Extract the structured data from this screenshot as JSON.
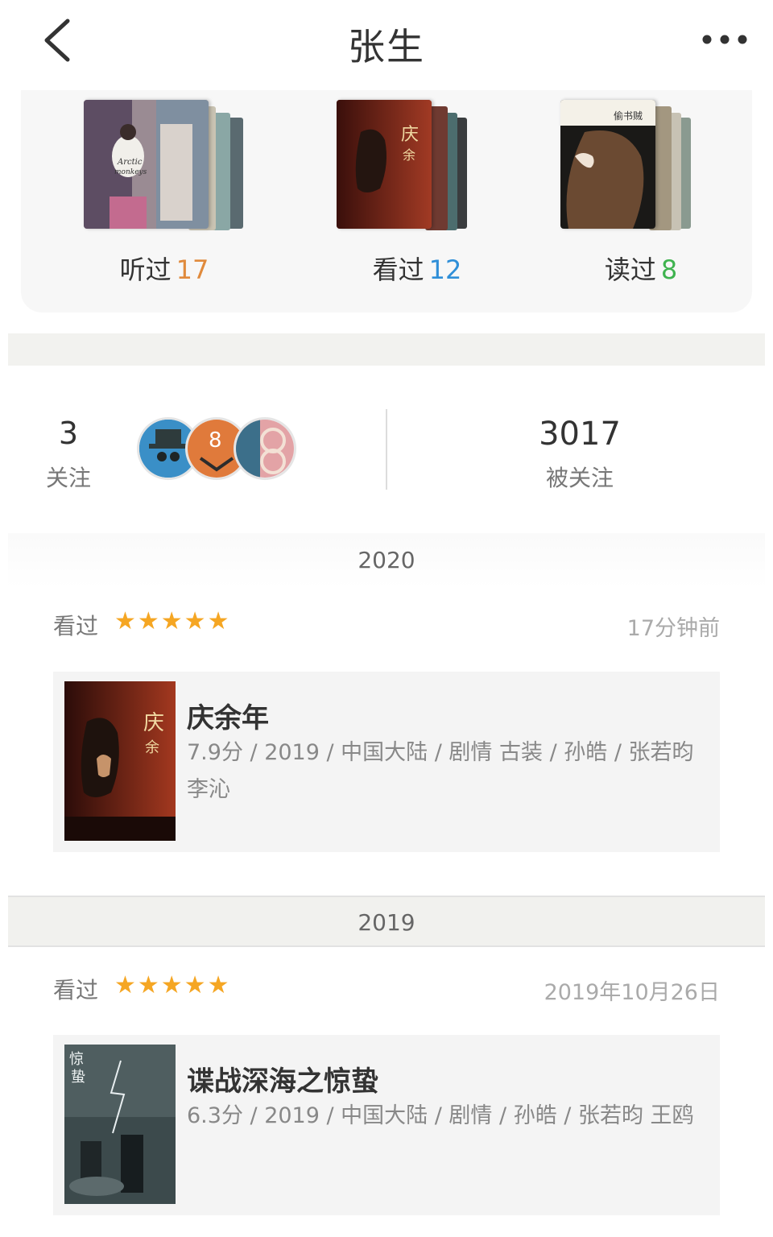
{
  "header": {
    "title": "张生",
    "back_icon": "chevron-left-icon",
    "more_icon": "more-dots-icon"
  },
  "collections": [
    {
      "label": "听过",
      "count": "17",
      "count_color": "#e08a3c"
    },
    {
      "label": "看过",
      "count": "12",
      "count_color": "#2f8fd8"
    },
    {
      "label": "读过",
      "count": "8",
      "count_color": "#3fb34f"
    }
  ],
  "follow": {
    "following_count": "3",
    "following_label": "关注",
    "followers_count": "3017",
    "followers_label": "被关注"
  },
  "years": {
    "first": "2020",
    "second": "2019"
  },
  "activities": [
    {
      "verb": "看过",
      "rating": "★★★★★",
      "time": "17分钟前",
      "title": "庆余年",
      "meta": "7.9分 / 2019 / 中国大陆 / 剧情 古装 / 孙皓 / 张若昀 李沁"
    },
    {
      "verb": "看过",
      "rating": "★★★★★",
      "time": "2019年10月26日",
      "title": "谍战深海之惊蛰",
      "meta": "6.3分 / 2019 / 中国大陆 / 剧情 / 孙皓 / 张若昀 王鸥"
    }
  ],
  "colors": {
    "star": "#f5a623",
    "card_bg": "#f4f4f4"
  }
}
